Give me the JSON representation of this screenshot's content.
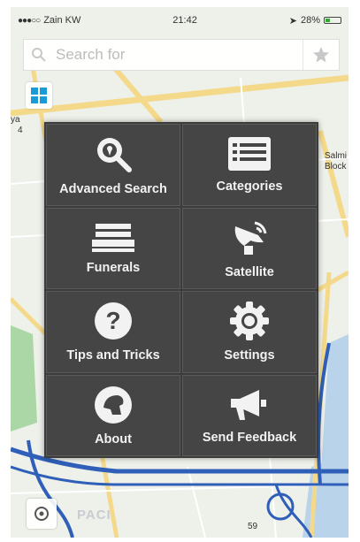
{
  "status_bar": {
    "carrier": "Zain KW",
    "time": "21:42",
    "battery": "28%"
  },
  "search": {
    "placeholder": "Search for"
  },
  "menu": {
    "items": [
      {
        "label": "Advanced Search",
        "icon": "advanced-search-icon"
      },
      {
        "label": "Categories",
        "icon": "categories-icon"
      },
      {
        "label": "Funerals",
        "icon": "funerals-icon"
      },
      {
        "label": "Satellite",
        "icon": "satellite-icon"
      },
      {
        "label": "Tips and Tricks",
        "icon": "help-icon"
      },
      {
        "label": "Settings",
        "icon": "gear-icon"
      },
      {
        "label": "About",
        "icon": "about-icon"
      },
      {
        "label": "Send Feedback",
        "icon": "megaphone-icon"
      }
    ]
  },
  "map": {
    "labels": [
      "Salmi",
      "Block",
      "ya",
      "4",
      "59"
    ]
  },
  "logo": {
    "text": "PACI"
  },
  "colors": {
    "menu_bg": "#3c3c3c",
    "tile_bg": "#454545",
    "grid_button": "#1a9ad6",
    "road_yellow": "#f5d98a",
    "road_blue": "#2f5fb8",
    "park_green": "#9fd29a"
  }
}
